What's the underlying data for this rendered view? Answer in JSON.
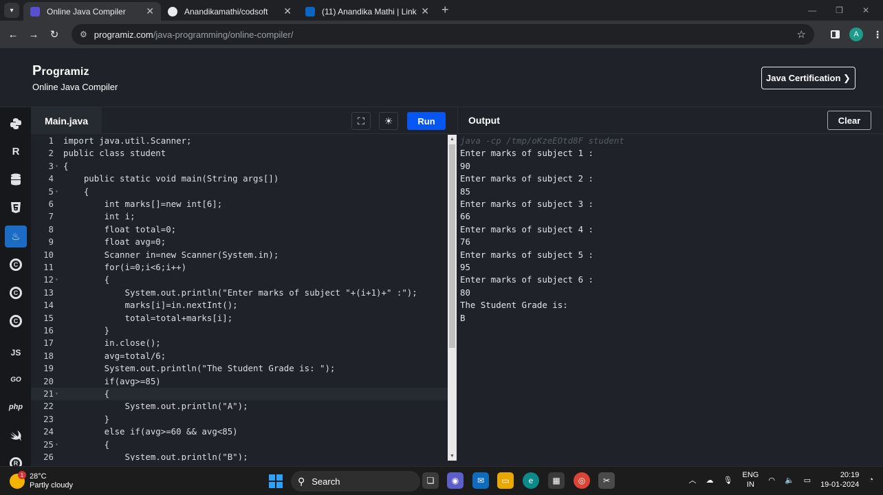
{
  "browser": {
    "tabs": [
      {
        "title": "Online Java Compiler",
        "active": true,
        "favicon": "programiz-icon"
      },
      {
        "title": "Anandikamathi/codsoft",
        "active": false,
        "favicon": "github-icon"
      },
      {
        "title": "(11) Anandika Mathi | LinkedIn",
        "active": false,
        "favicon": "linkedin-icon"
      }
    ],
    "url_host": "programiz.com",
    "url_path": "/java-programming/online-compiler/",
    "profile_initial": "A"
  },
  "site": {
    "logo_p": "P",
    "logo_rest": "rogramiz",
    "subtitle": "Online Java Compiler",
    "cert_button": "Java Certification ❯"
  },
  "rail": {
    "items": [
      "python-icon",
      "r-icon",
      "sql-icon",
      "html5-icon",
      "java-icon",
      "c-icon",
      "cpp-icon",
      "csharp-icon",
      "JS",
      "GO",
      "php",
      "swift-icon",
      "rust-icon"
    ]
  },
  "editor": {
    "file_tab": "Main.java",
    "run_label": "Run",
    "lines": [
      {
        "n": "1",
        "t": "import java.util.Scanner;"
      },
      {
        "n": "2",
        "t": "public class student"
      },
      {
        "n": "3",
        "t": "{"
      },
      {
        "n": "4",
        "t": "    public static void main(String args[])"
      },
      {
        "n": "5",
        "t": "    {"
      },
      {
        "n": "6",
        "t": "        int marks[]=new int[6];"
      },
      {
        "n": "7",
        "t": "        int i;"
      },
      {
        "n": "8",
        "t": "        float total=0;"
      },
      {
        "n": "9",
        "t": "        float avg=0;"
      },
      {
        "n": "10",
        "t": "        Scanner in=new Scanner(System.in);"
      },
      {
        "n": "11",
        "t": "        for(i=0;i<6;i++)"
      },
      {
        "n": "12",
        "t": "        {"
      },
      {
        "n": "13",
        "t": "            System.out.println(\"Enter marks of subject \"+(i+1)+\" :\");"
      },
      {
        "n": "14",
        "t": "            marks[i]=in.nextInt();"
      },
      {
        "n": "15",
        "t": "            total=total+marks[i];"
      },
      {
        "n": "16",
        "t": "        }"
      },
      {
        "n": "17",
        "t": "        in.close();"
      },
      {
        "n": "18",
        "t": "        avg=total/6;"
      },
      {
        "n": "19",
        "t": "        System.out.println(\"The Student Grade is: \");"
      },
      {
        "n": "20",
        "t": "        if(avg>=85)"
      },
      {
        "n": "21",
        "t": "        {"
      },
      {
        "n": "22",
        "t": "            System.out.println(\"A\");"
      },
      {
        "n": "23",
        "t": "        }"
      },
      {
        "n": "24",
        "t": "        else if(avg>=60 && avg<85)"
      },
      {
        "n": "25",
        "t": "        {"
      },
      {
        "n": "26",
        "t": "            System.out.println(\"B\");"
      }
    ]
  },
  "output": {
    "title": "Output",
    "clear_label": "Clear",
    "command": "java -cp /tmp/oKzeEOtd8F student",
    "lines": [
      "Enter marks of subject 1 :",
      "90",
      "Enter marks of subject 2 :",
      "85",
      "Enter marks of subject 3 :",
      "66",
      "Enter marks of subject 4 :",
      "76",
      "Enter marks of subject 5 :",
      "95",
      "Enter marks of subject 6 :",
      "80",
      "The Student Grade is:",
      "B"
    ]
  },
  "taskbar": {
    "temperature": "28°C",
    "weather": "Partly cloudy",
    "weather_badge": "1",
    "search_label": "Search",
    "lang_1": "ENG",
    "lang_2": "IN",
    "time": "20:19",
    "date": "19-01-2024"
  },
  "colors": {
    "run_button": "#0556f3",
    "active_rail": "#1a6cc4",
    "page_bg": "#1f2229"
  }
}
